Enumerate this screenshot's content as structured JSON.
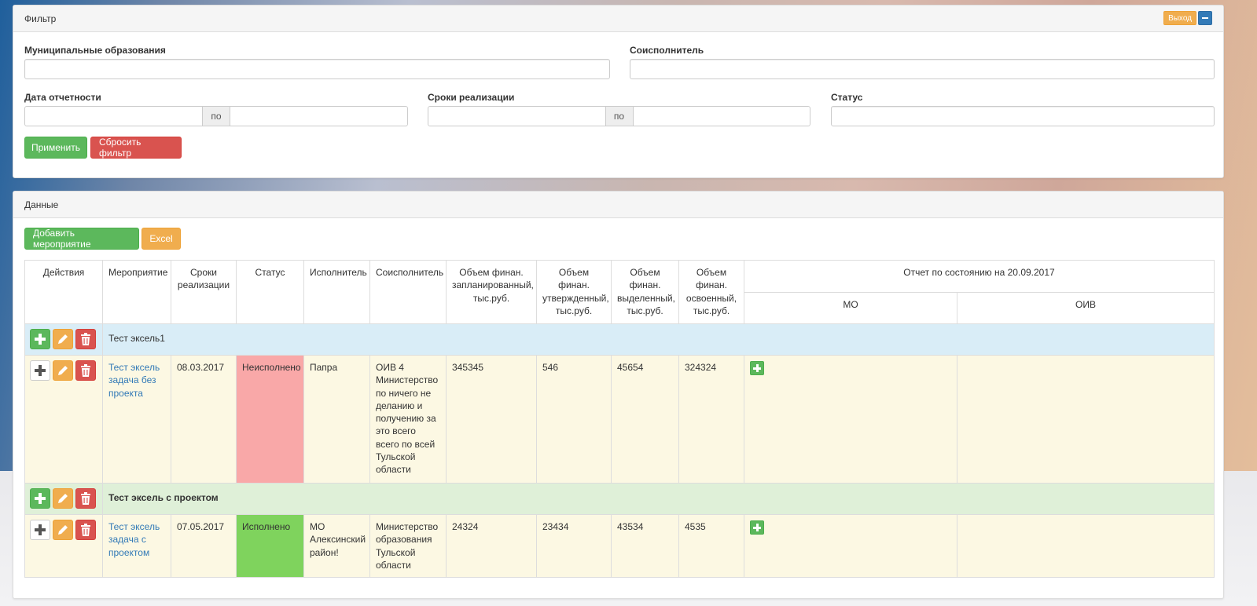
{
  "filter": {
    "title": "Фильтр",
    "exit_label": "Выход",
    "municipal_label": "Муниципальные образования",
    "municipal_value": "",
    "coexec_label": "Соисполнитель",
    "coexec_value": "",
    "report_date_label": "Дата отчетности",
    "report_date_sep": "по",
    "terms_label": "Сроки реализации",
    "terms_sep": "по",
    "status_label": "Статус",
    "status_value": "",
    "apply_label": "Применить",
    "reset_label": "Сбросить фильтр"
  },
  "data_panel": {
    "title": "Данные",
    "add_label": "Добавить мероприятие",
    "excel_label": "Excel"
  },
  "table": {
    "headers": {
      "actions": "Действия",
      "event": "Мероприятие",
      "terms": "Сроки реализации",
      "status": "Статус",
      "executor": "Исполнитель",
      "coexecutor": "Соисполнитель",
      "vol_planned": "Объем финан. запланированный, тыс.руб.",
      "vol_approved": "Объем финан. утвержденный, тыс.руб.",
      "vol_allocated": "Объем финан. выделенный, тыс.руб.",
      "vol_spent": "Объем финан. освоенный, тыс.руб.",
      "report": "Отчет по состоянию на 20.09.2017",
      "mo": "МО",
      "oiv": "ОИВ"
    },
    "groups": [
      {
        "name": "Тест эксель1",
        "rows": [
          {
            "event": "Тест эксель задача без проекта",
            "terms": "08.03.2017",
            "status": "Неисполнено",
            "executor": "Папра",
            "coexecutor": "ОИВ 4 Министерство по ничего не деланию и получению за это всего всего по всей Тульской области",
            "vol_planned": "345345",
            "vol_approved": "546",
            "vol_allocated": "45654",
            "vol_spent": "324324"
          }
        ]
      },
      {
        "name": "Тест эксель с проектом",
        "rows": [
          {
            "event": "Тест эксель задача с проектом",
            "terms": "07.05.2017",
            "status": "Исполнено",
            "executor": "МО Алексинский район!",
            "coexecutor": "Министерство образования Тульской области",
            "vol_planned": "24324",
            "vol_approved": "23434",
            "vol_allocated": "43534",
            "vol_spent": "4535"
          }
        ]
      }
    ]
  },
  "colors": {
    "success": "#5cb85c",
    "danger": "#d9534f",
    "warning": "#f0ad4e",
    "primary": "#337ab7",
    "status_bad": "#f9a8a8",
    "status_ok": "#7fd35d"
  }
}
